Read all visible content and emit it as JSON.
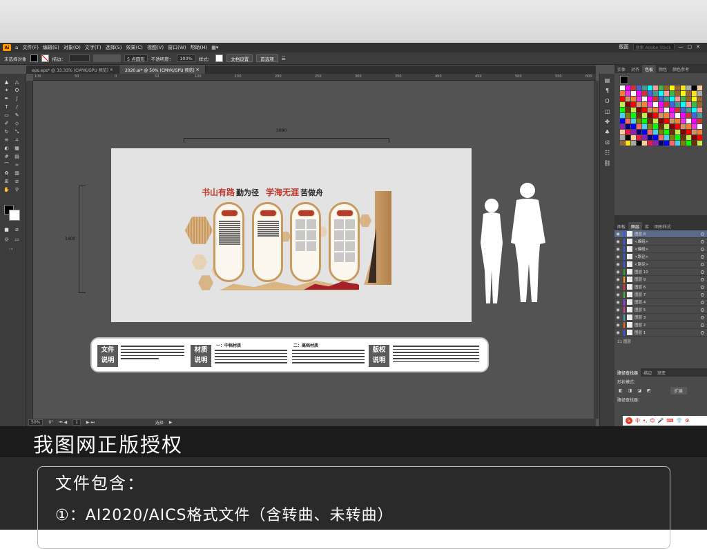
{
  "menubar": {
    "logo": "Ai",
    "items": [
      "文件(F)",
      "编辑(E)",
      "对象(O)",
      "文字(T)",
      "选择(S)",
      "效果(C)",
      "视图(V)",
      "窗口(W)",
      "帮助(H)"
    ],
    "workspace": "版面",
    "search_placeholder": "搜索 Adobe Stock"
  },
  "control_bar": {
    "selection": "未选择对象",
    "stroke_label": "描边：",
    "brush": "5 点圆形",
    "opacity_label": "不透明度：",
    "opacity_value": "100%",
    "style_label": "样式：",
    "doc_setup": "文档设置",
    "preferences": "首选项"
  },
  "doc_tabs": [
    {
      "label": "eps.eps* @ 33.33% (CMYK/GPU 预览)"
    },
    {
      "label": "2020.ai* @ 50% (CMYK/GPU 预览)"
    }
  ],
  "ruler_top": [
    "100",
    "50",
    "0",
    "50",
    "100",
    "150",
    "200",
    "250",
    "300",
    "350",
    "400",
    "450",
    "500",
    "550",
    "600"
  ],
  "status": {
    "zoom": "50%",
    "angle": "0°",
    "artboard_num": "1",
    "tool": "选择"
  },
  "panel": {
    "tabs_top": [
      "实体",
      "对齐",
      "色板",
      "颜色",
      "颜色参考"
    ],
    "tabs_layers": [
      "图板",
      "图层",
      "库",
      "图形样式"
    ],
    "layers": [
      {
        "name": "图层 8",
        "selected": true,
        "color": "#3355ff"
      },
      {
        "name": "<编组>",
        "selected": false,
        "color": "#3355ff"
      },
      {
        "name": "<编组>",
        "selected": false,
        "color": "#3355ff"
      },
      {
        "name": "<路径>",
        "selected": false,
        "color": "#3355ff"
      },
      {
        "name": "<路径>",
        "selected": false,
        "color": "#3355ff"
      },
      {
        "name": "图层 10",
        "selected": false,
        "color": "#22aa22"
      },
      {
        "name": "图层 9",
        "selected": false,
        "color": "#ff9900"
      },
      {
        "name": "图层 6",
        "selected": false,
        "color": "#ee3333"
      },
      {
        "name": "图层 7",
        "selected": false,
        "color": "#33bb33"
      },
      {
        "name": "图层 4",
        "selected": false,
        "color": "#aa33ff"
      },
      {
        "name": "图层 5",
        "selected": false,
        "color": "#dd33aa"
      },
      {
        "name": "图层 3",
        "selected": false,
        "color": "#33aaaa"
      },
      {
        "name": "图层 2",
        "selected": false,
        "color": "#ff6600"
      },
      {
        "name": "图层 1",
        "selected": false,
        "color": "#3355ff"
      }
    ],
    "layers_count": "11 图层",
    "pathfinder_tabs": [
      "路径查找器",
      "描边",
      "渐变"
    ],
    "shape_modes": "形状模式：",
    "expand_btn": "扩展",
    "pathfinders": "路径查找器："
  },
  "ime": {
    "label": "中"
  },
  "artwork": {
    "dim_width": "3090",
    "dim_height": "1600",
    "headline_red1": "书山有路",
    "headline_dark1": "勤为径",
    "headline_red2": "学海无涯",
    "headline_dark2": "苦做舟"
  },
  "legend": {
    "file_label": "文件\n说明",
    "material_label": "材质\n说明",
    "copyright_label": "版权\n说明",
    "mid_grade": "一：中档材质",
    "high_grade": "二：高档材质"
  },
  "banner": {
    "title": "我图网正版授权"
  },
  "bottom": {
    "line1": "文件包含：",
    "line2": "①：AI2020/AICS格式文件（含转曲、未转曲）"
  },
  "colors": {
    "accent_red": "#c23a2c",
    "wood": "#c99a5f",
    "app_bg": "#535353"
  }
}
